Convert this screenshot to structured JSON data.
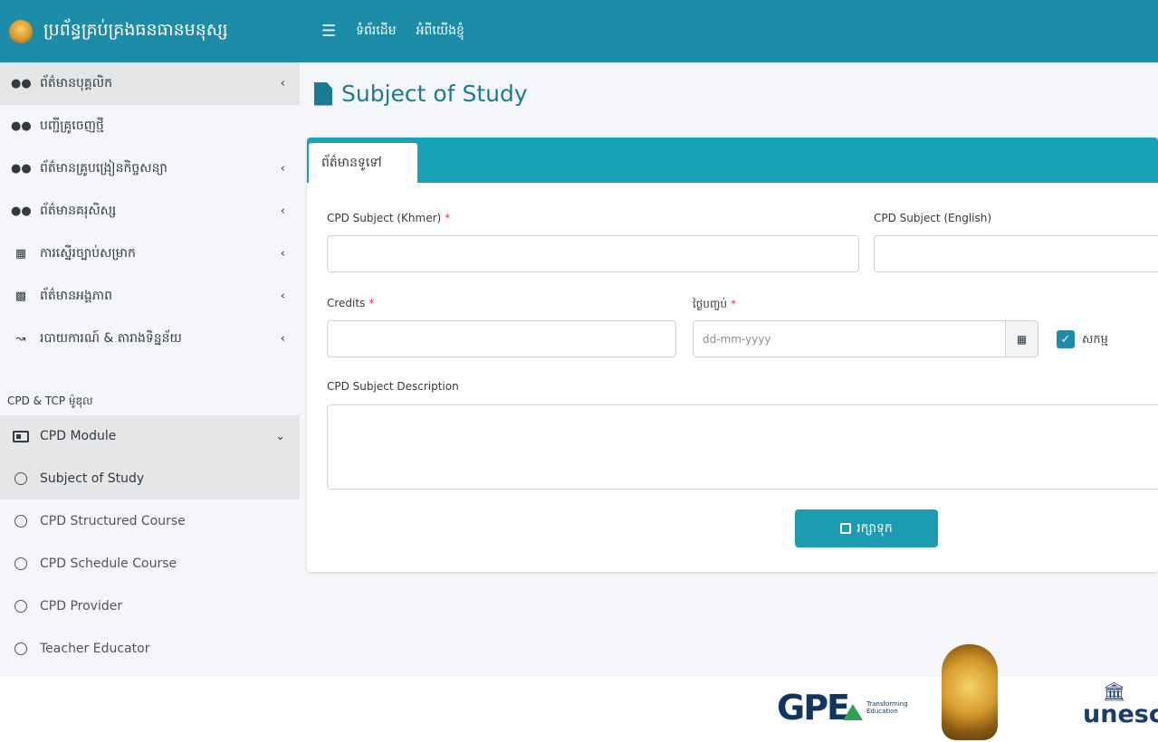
{
  "app": {
    "title": "ប្រព័ន្ធគ្រប់គ្រងធនធានមនុស្ស"
  },
  "navbar": {
    "links": [
      "ទំព័រដើម",
      "អំពីយើងខ្ញុំ"
    ]
  },
  "sidebar": {
    "items": [
      {
        "label": "ព័ត៌មានបុគ្គលិក",
        "icon": "users-icon",
        "has_chevron": true
      },
      {
        "label": "បញ្ជីគ្រូចេញថ្មី",
        "icon": "users-icon",
        "has_chevron": false
      },
      {
        "label": "ព័ត៌មានគ្រូបង្រៀនកិច្ចសន្យា",
        "icon": "users-icon",
        "has_chevron": true
      },
      {
        "label": "ព័ត៌មានគរុសិស្ស",
        "icon": "users-icon",
        "has_chevron": true
      },
      {
        "label": "ការស្នើរច្បាប់សម្រាក",
        "icon": "calendar-check-icon",
        "has_chevron": true
      },
      {
        "label": "ព័ត៌មានអង្គភាព",
        "icon": "building-icon",
        "has_chevron": true
      },
      {
        "label": "របាយការណ៍ & តារាងទិន្នន័យ",
        "icon": "chart-line-icon",
        "has_chevron": true
      }
    ],
    "section_header": "CPD & TCP ម៉ូឌុល",
    "module": {
      "label": "CPD Module",
      "icon": "id-card-icon"
    },
    "sub_items": [
      "Subject of Study",
      "CPD Structured Course",
      "CPD Schedule Course",
      "CPD Provider",
      "Teacher Educator"
    ]
  },
  "page": {
    "title": "Subject of Study",
    "tab": "ព័ត៌មានទូទៅ"
  },
  "form": {
    "subject_khmer_label": "CPD Subject (Khmer)",
    "subject_english_label": "CPD Subject (English)",
    "credits_label": "Credits",
    "expiry_label": "ថ្ងៃបញ្ចប់",
    "date_placeholder": "dd-mm-yyyy",
    "active_label": "សកម្ម",
    "active_checked": true,
    "description_label": "CPD Subject Description",
    "required_mark": "*",
    "save_label": "រក្សាទុក"
  },
  "footer": {
    "gpe_text": "GPE",
    "gpe_tagline_1": "Transforming",
    "gpe_tagline_2": "Education",
    "unesco_text": "unesco"
  },
  "colors": {
    "primary": "#1d8ca8",
    "tab_bar": "#17a2b8",
    "title": "#1a7b95",
    "required": "#dc3545"
  }
}
